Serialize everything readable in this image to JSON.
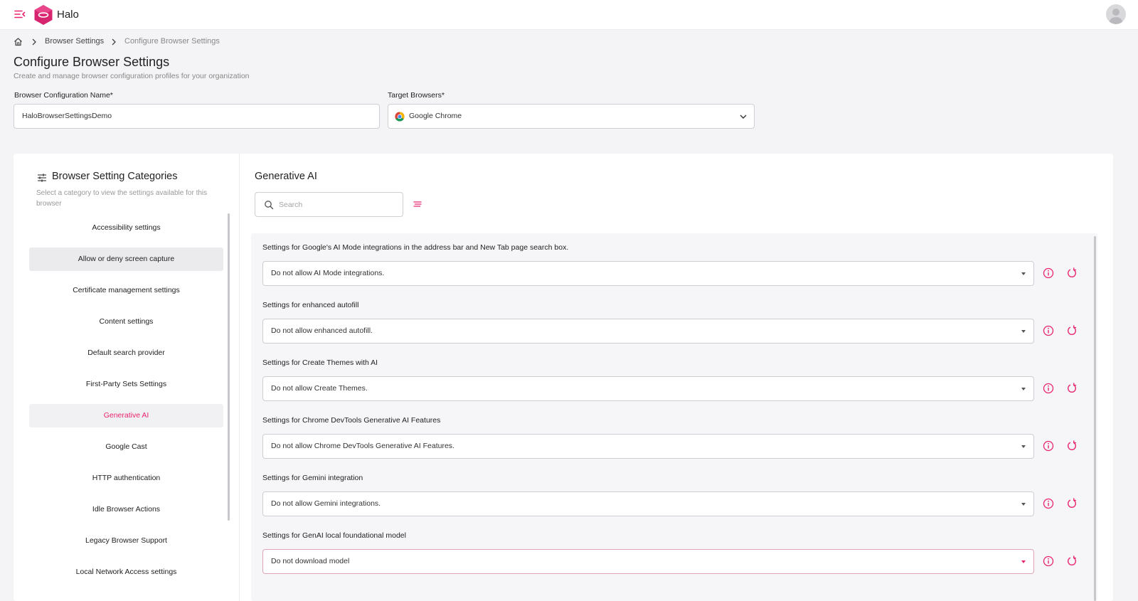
{
  "app": {
    "name": "Halo",
    "accent_color": "#e8246f",
    "logo_color": "#d6246f",
    "icons": {
      "menu": "menu-collapse-icon",
      "logo": "halo-hexagon-logo",
      "avatar": "user-avatar-icon"
    }
  },
  "breadcrumb": {
    "home_icon": "home-icon",
    "items": [
      "Browser Settings",
      "Configure Browser Settings"
    ]
  },
  "page": {
    "title": "Configure Browser Settings",
    "subtitle": "Create and manage browser configuration profiles for your organization"
  },
  "form": {
    "config_name_label": "Browser Configuration Name*",
    "config_name_value": "HaloBrowserSettingsDemo",
    "target_browsers_label": "Target Browsers*",
    "target_browsers_value": "Google Chrome",
    "browser_icon": "google-chrome-icon"
  },
  "categories": {
    "title": "Browser Setting Categories",
    "subtitle": "Select a category to view the settings available for this browser",
    "items": [
      {
        "label": "Accessibility settings",
        "state": "normal"
      },
      {
        "label": "Allow or deny screen capture",
        "state": "hover"
      },
      {
        "label": "Certificate management settings",
        "state": "normal"
      },
      {
        "label": "Content settings",
        "state": "normal"
      },
      {
        "label": "Default search provider",
        "state": "normal"
      },
      {
        "label": "First-Party Sets Settings",
        "state": "normal"
      },
      {
        "label": "Generative AI",
        "state": "active"
      },
      {
        "label": "Google Cast",
        "state": "normal"
      },
      {
        "label": "HTTP authentication",
        "state": "normal"
      },
      {
        "label": "Idle Browser Actions",
        "state": "normal"
      },
      {
        "label": "Legacy Browser Support",
        "state": "normal"
      },
      {
        "label": "Local Network Access settings",
        "state": "normal"
      }
    ]
  },
  "section": {
    "title": "Generative AI",
    "search_placeholder": "Search",
    "settings": [
      {
        "label": "Settings for Google's AI Mode integrations in the address bar and New Tab page search box.",
        "value": "Do not allow AI Mode integrations."
      },
      {
        "label": "Settings for enhanced autofill",
        "value": "Do not allow enhanced autofill."
      },
      {
        "label": "Settings for Create Themes with AI",
        "value": "Do not allow Create Themes."
      },
      {
        "label": "Settings for Chrome DevTools Generative AI Features",
        "value": "Do not allow Chrome DevTools Generative AI Features."
      },
      {
        "label": "Settings for Gemini integration",
        "value": "Do not allow Gemini integrations."
      },
      {
        "label": "Settings for GenAI local foundational model",
        "value": "Do not download model"
      }
    ]
  }
}
